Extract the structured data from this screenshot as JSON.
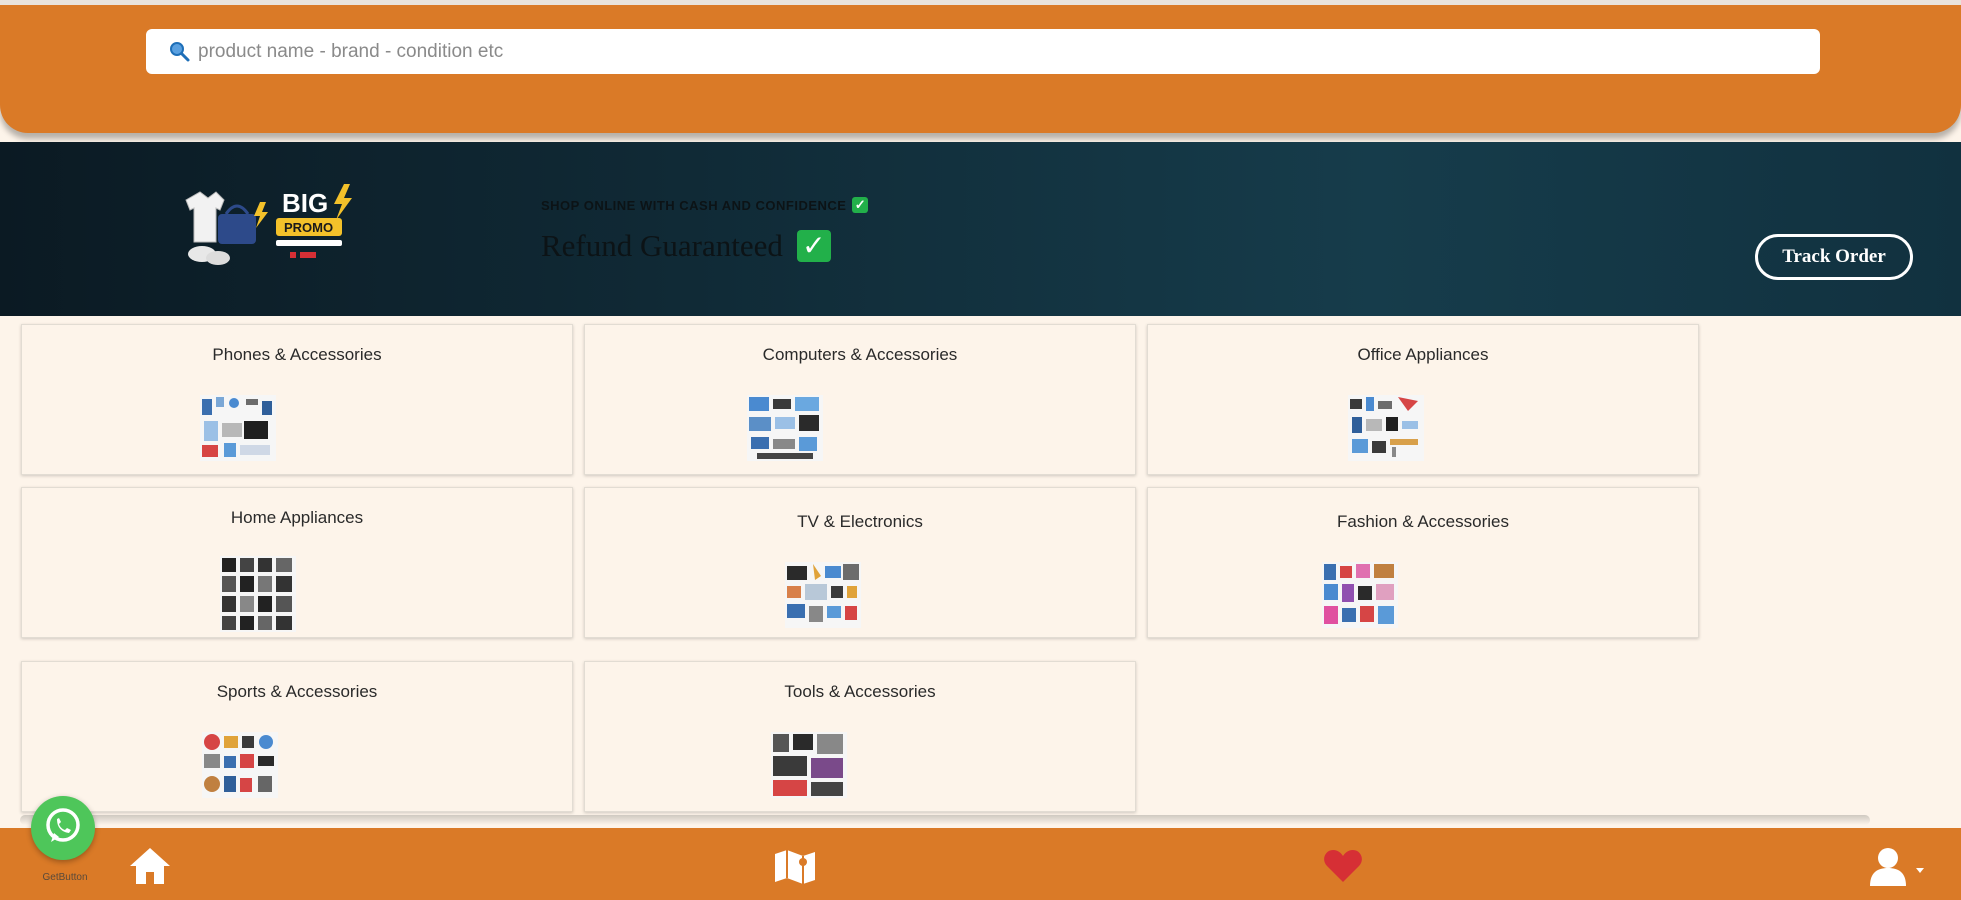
{
  "search": {
    "placeholder": "product name - brand - condition etc",
    "icon": "search-icon"
  },
  "banner": {
    "promo_logo_text": "BIG PROMO",
    "small_text": "SHOP ONLINE WITH CASH AND CONFIDENCE",
    "main_text": "Refund Guaranteed",
    "track_order_label": "Track Order"
  },
  "categories": [
    {
      "label": "Phones & Accessories"
    },
    {
      "label": "Computers & Accessories"
    },
    {
      "label": "Office Appliances"
    },
    {
      "label": "Home Appliances"
    },
    {
      "label": "TV & Electronics"
    },
    {
      "label": "Fashion & Accessories"
    },
    {
      "label": "Sports & Accessories"
    },
    {
      "label": "Tools & Accessories"
    }
  ],
  "bottom_nav": {
    "items": [
      {
        "icon": "home-icon"
      },
      {
        "icon": "map-icon"
      },
      {
        "icon": "heart-icon"
      },
      {
        "icon": "user-icon"
      }
    ]
  },
  "whatsapp": {
    "caption": "GetButton"
  },
  "colors": {
    "primary_orange": "#da7a27",
    "banner_dark": "#102a36",
    "background": "#fdf4ea",
    "check_green": "#22b04a",
    "heart_red": "#d62f35",
    "whatsapp_green": "#4ec65a"
  }
}
